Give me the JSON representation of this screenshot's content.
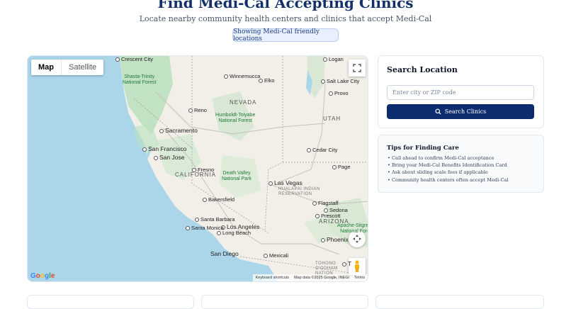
{
  "header": {
    "title": "Find Medi-Cal Accepting Clinics",
    "subtitle": "Locate nearby community health centers and clinics that accept Medi-Cal",
    "badge": "Showing Medi-Cal friendly locations"
  },
  "map": {
    "type_buttons": {
      "map": "Map",
      "satellite": "Satellite"
    },
    "selected_type": "Map",
    "labels": {
      "crescent_city": "Crescent City",
      "logan": "Logan",
      "shasta": "Shasta-Trinity\nNational Forest",
      "winnemucca": "Winnemucca",
      "elko": "Elko",
      "salt_lake_city": "Salt Lake City",
      "provo": "Provo",
      "nevada": "NEVADA",
      "reno": "Reno",
      "humboldt": "Humboldt-Toiyabe\nNational Forest",
      "utah": "UTAH",
      "sacramento": "Sacramento",
      "san_francisco": "San Francisco",
      "san_jose": "San Jose",
      "cedar_city": "Cedar City",
      "california": "CALIFORNIA",
      "fresno": "Fresno",
      "death_valley": "Death Valley\nNational Park",
      "las_vegas": "Las Vegas",
      "page": "Page",
      "hualapai": "HUALAPAI INDIAN\nRESERVATION",
      "bakersfield": "Bakersfield",
      "flagstaff": "Flagstaff",
      "sedona": "Sedona",
      "prescott": "Prescott",
      "santa_barbara": "Santa Barbara",
      "arizona": "ARIZONA",
      "santa_monica": "Santa Monica",
      "los_angeles": "Los Angeles",
      "long_beach": "Long Beach",
      "apache": "Apache-Sitgreaves\nNational Forests",
      "phoenix": "Phoenix",
      "san_diego": "San Diego",
      "mexicali": "Mexicali",
      "tohono": "TOHONO\nO'ODHAM\nNATION\nRESERVATION",
      "tucson": "T"
    },
    "attribution": {
      "shortcuts": "Keyboard shortcuts",
      "data": "Map data ©2025 Google, INEGI",
      "terms": "Terms"
    },
    "logo": "Google",
    "icons": [
      "fullscreen-icon",
      "pan-control-icon",
      "pegman-icon"
    ]
  },
  "search": {
    "heading": "Search Location",
    "placeholder": "Enter city or ZIP code",
    "value": "",
    "button_label": "Search Clinics",
    "button_icon": "search-icon"
  },
  "tips": {
    "heading": "Tips for Finding Care",
    "items": [
      "• Call ahead to confirm Medi-Cal acceptance",
      "• Bring your Medi-Cal Benefits Identification Card",
      "• Ask about sliding scale fees if applicable",
      "• Community health centers often accept Medi-Cal"
    ]
  },
  "colors": {
    "title": "#14306b",
    "button": "#0b2d6f",
    "badge_bg": "#e8f0fe",
    "water": "#abd6ea",
    "land": "#f1efe8",
    "park": "#b9e1bd"
  }
}
